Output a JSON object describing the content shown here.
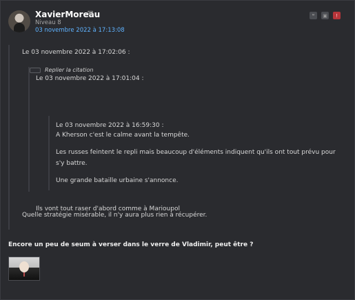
{
  "post": {
    "author": {
      "username": "XavierMoreau",
      "level": "Niveau 8",
      "timestamp": "03 novembre 2022 à 17:13:08",
      "mail_icon": "mail-icon"
    },
    "actions": [
      {
        "name": "quote-icon"
      },
      {
        "name": "edit-icon"
      },
      {
        "name": "report-icon"
      }
    ],
    "quote_level_1": {
      "header": "Le 03 novembre 2022 à 17:02:06 :",
      "reply_quote_label": "Replier la citation",
      "quote_level_2": {
        "header": "Le 03 novembre 2022 à 17:01:04 :",
        "quote_level_3": {
          "header": "Le 03 novembre 2022 à 16:59:30 :",
          "lines": [
            "A Kherson c'est le calme avant la tempête.",
            "Les russes feintent le repli mais beaucoup d'éléments indiquent qu'ils ont tout prévu pour",
            "s'y battre.",
            "Une grande bataille urbaine s'annonce."
          ]
        },
        "after_text": "Ils vont tout raser d'abord comme à Marioupol"
      },
      "after_text": "Quelle stratégie misérable, il n'y aura plus rien à récupérer."
    },
    "final_message": "Encore un peu de seum à verser dans le verre de Vladimir, peut être ?",
    "attached_image": {
      "name": "post-image"
    }
  }
}
